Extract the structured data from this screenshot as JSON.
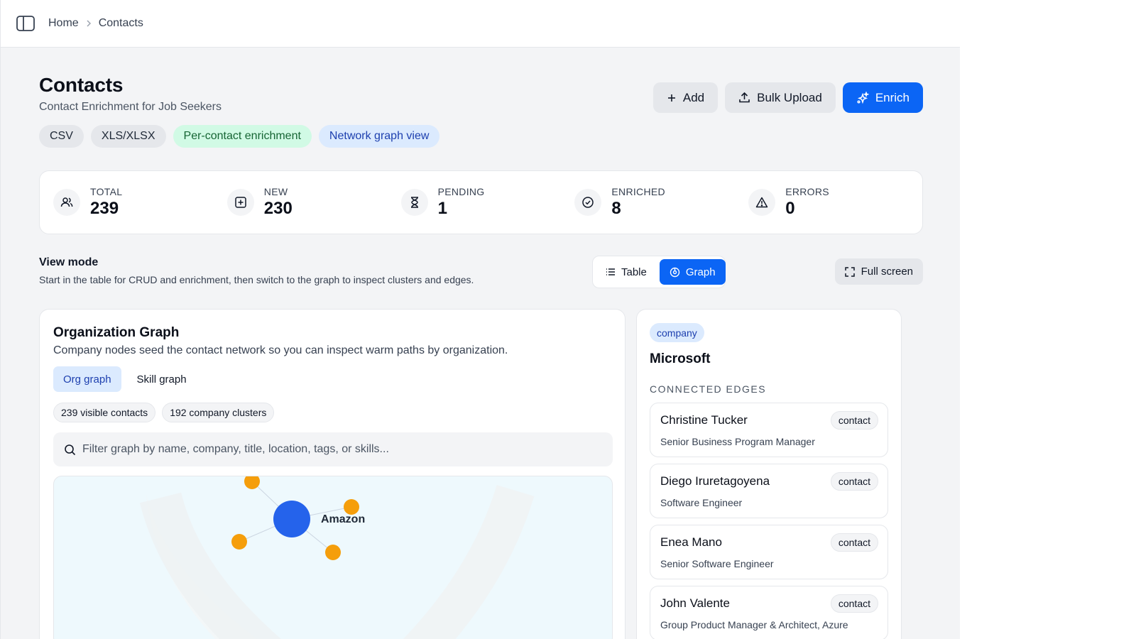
{
  "breadcrumb": {
    "home": "Home",
    "current": "Contacts"
  },
  "header": {
    "title": "Contacts",
    "subtitle": "Contact Enrichment for Job Seekers",
    "chips": [
      "CSV",
      "XLS/XLSX",
      "Per-contact enrichment",
      "Network graph view"
    ]
  },
  "actions": {
    "add": "Add",
    "bulk_upload": "Bulk Upload",
    "enrich": "Enrich"
  },
  "stats": [
    {
      "label": "TOTAL",
      "value": "239",
      "icon": "users-icon"
    },
    {
      "label": "NEW",
      "value": "230",
      "icon": "plus-square-icon"
    },
    {
      "label": "PENDING",
      "value": "1",
      "icon": "hourglass-icon"
    },
    {
      "label": "ENRICHED",
      "value": "8",
      "icon": "check-circle-icon"
    },
    {
      "label": "ERRORS",
      "value": "0",
      "icon": "warning-triangle-icon"
    }
  ],
  "view_mode": {
    "title": "View mode",
    "description": "Start in the table for CRUD and enrichment, then switch to the graph to inspect clusters and edges.",
    "table_label": "Table",
    "graph_label": "Graph",
    "active": "graph",
    "fullscreen_label": "Full screen"
  },
  "graph": {
    "title": "Organization Graph",
    "description": "Company nodes seed the contact network so you can inspect warm paths by organization.",
    "tabs": {
      "org": "Org graph",
      "skill": "Skill graph",
      "active": "org"
    },
    "badges": [
      "239 visible contacts",
      "192 company clusters"
    ],
    "search_placeholder": "Filter graph by name, company, title, location, tags, or skills...",
    "node_label": "Amazon",
    "colors": {
      "company_node": "#2563eb",
      "contact_node": "#f59e0b",
      "background": "#eef9fd"
    }
  },
  "detail": {
    "type_chip": "company",
    "name": "Microsoft",
    "section_label": "CONNECTED EDGES",
    "edges": [
      {
        "name": "Christine Tucker",
        "title": "Senior Business Program Manager",
        "badge": "contact"
      },
      {
        "name": "Diego Iruretagoyena",
        "title": "Software Engineer",
        "badge": "contact"
      },
      {
        "name": "Enea Mano",
        "title": "Senior Software Engineer",
        "badge": "contact"
      },
      {
        "name": "John Valente",
        "title": "Group Product Manager & Architect, Azure",
        "badge": "contact"
      }
    ]
  },
  "accent_color": "#0b65f5"
}
